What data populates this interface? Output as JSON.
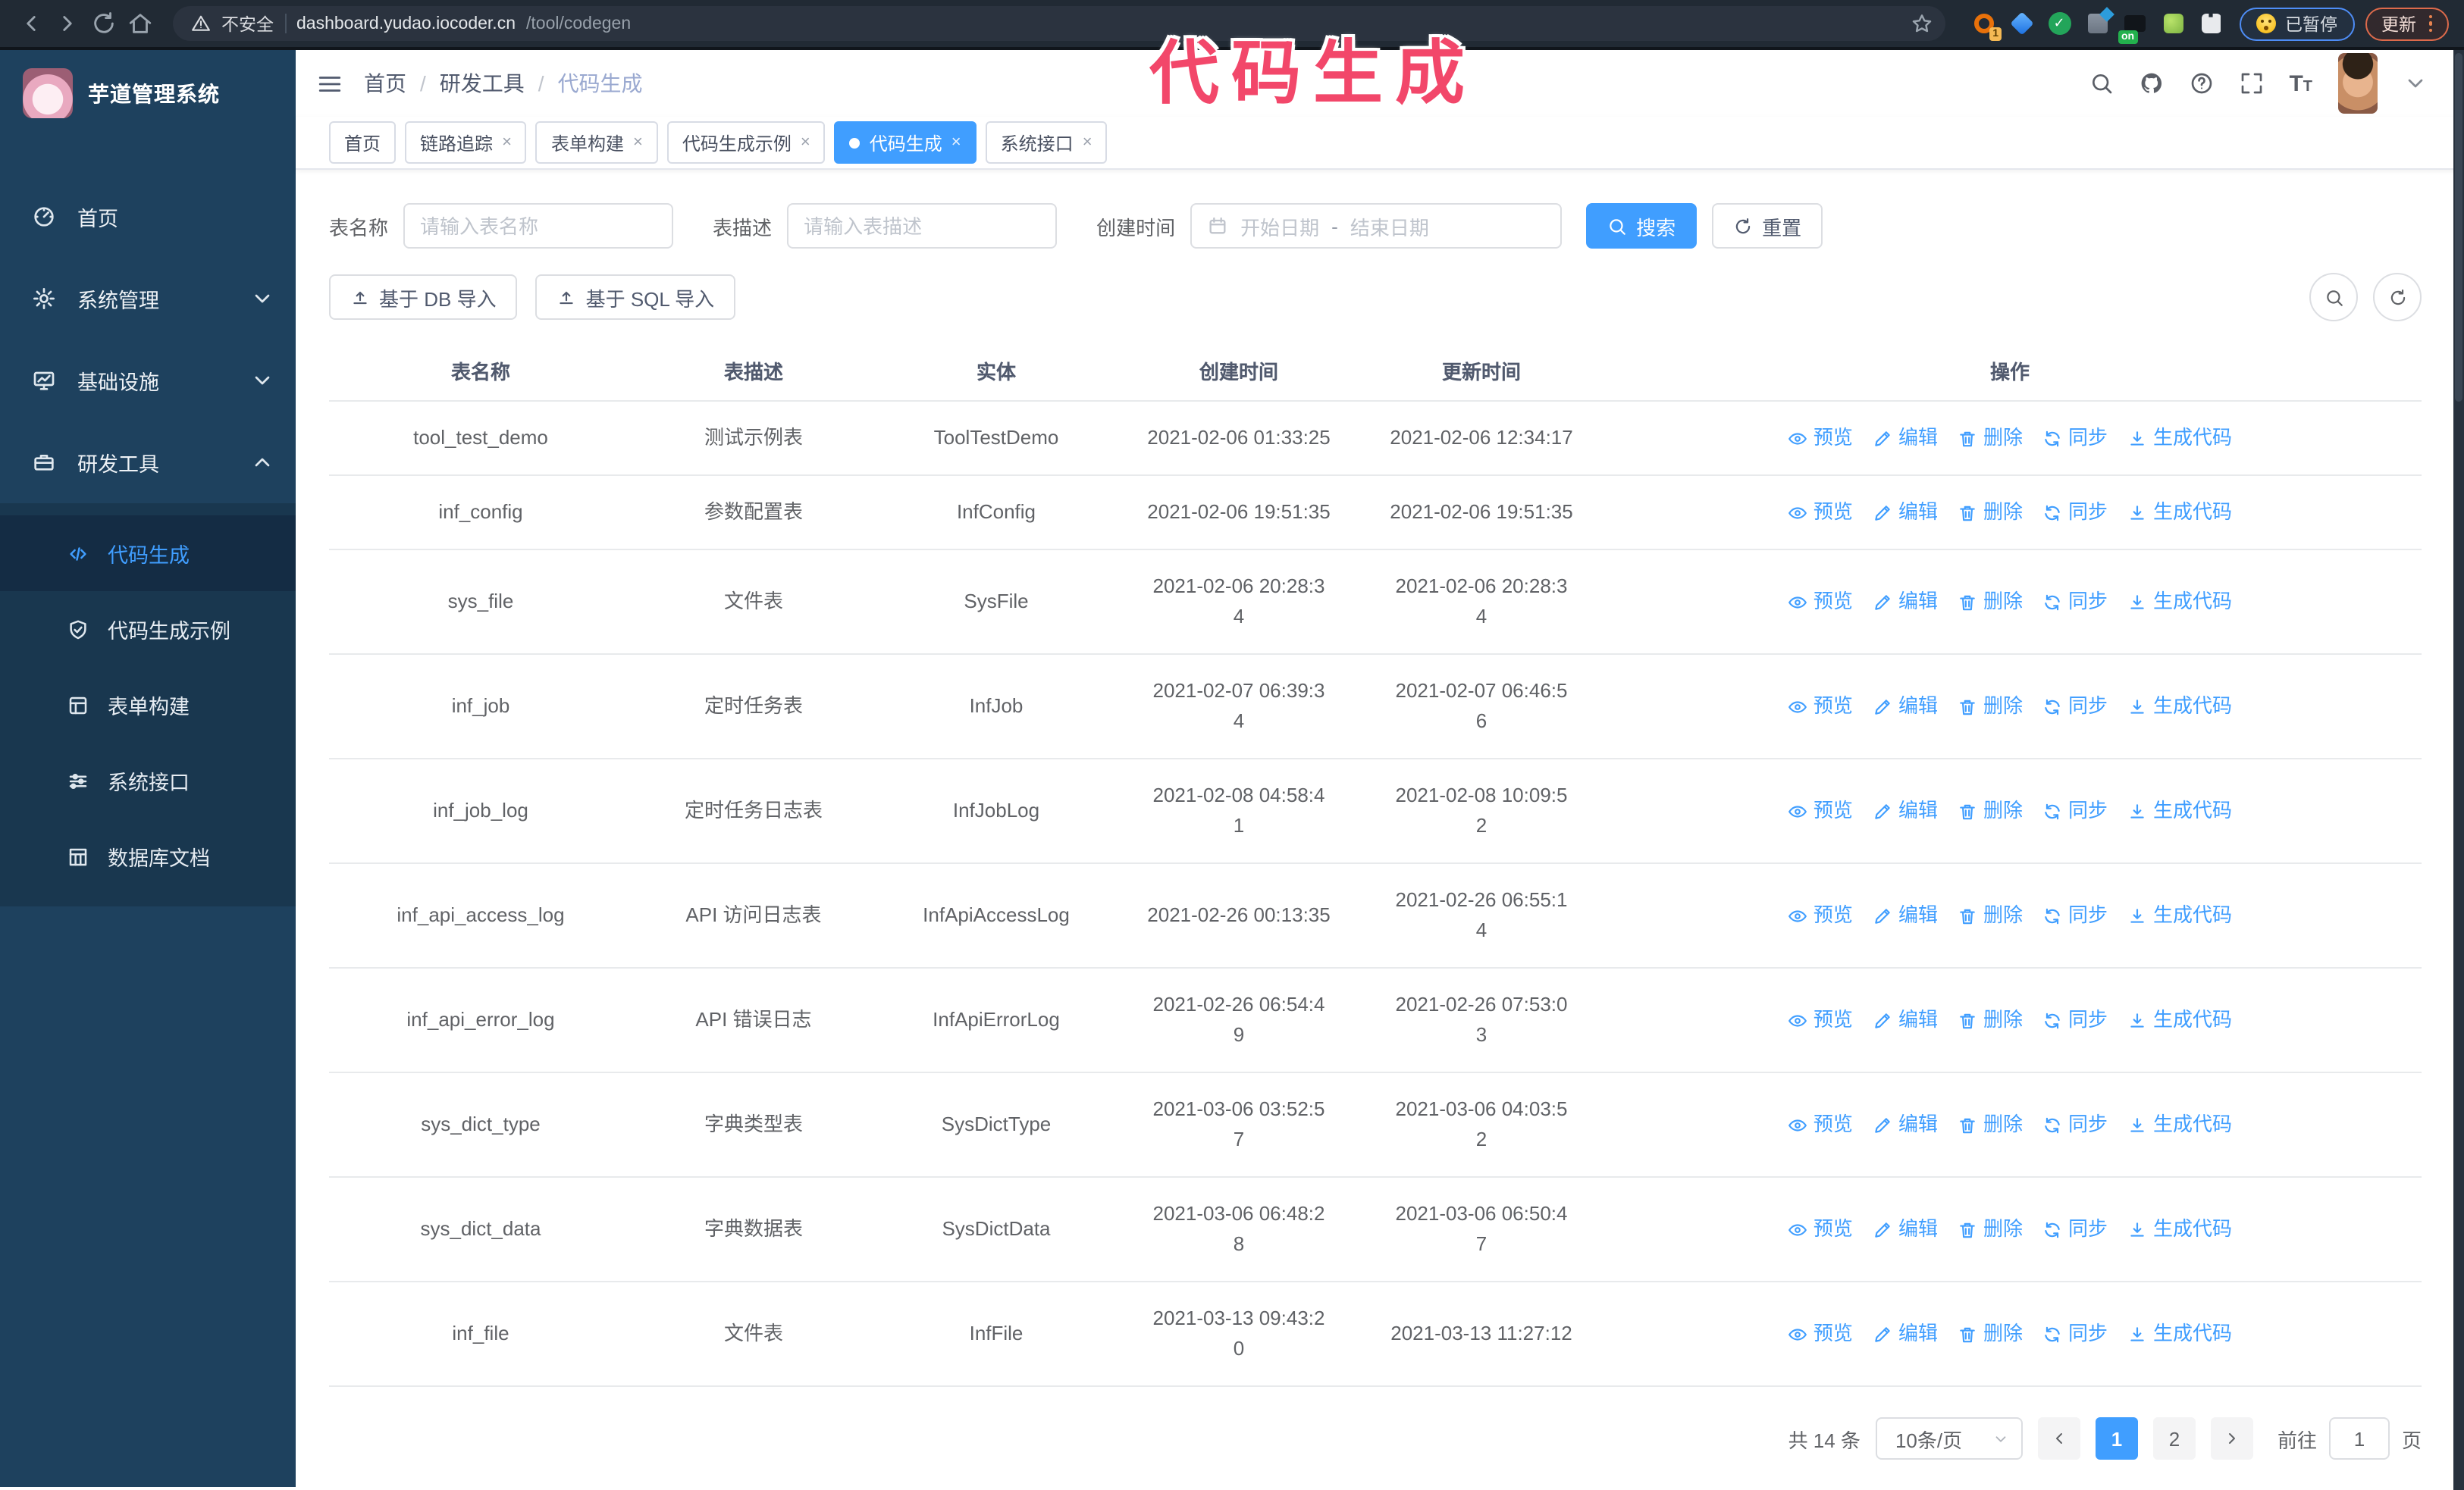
{
  "browser": {
    "security_label": "不安全",
    "url_host": "dashboard.yudao.iocoder.cn",
    "url_path": "/tool/codegen",
    "extension_badge": "1",
    "extension_on_label": "on",
    "paused_label": "已暂停",
    "update_label": "更新"
  },
  "annotation": {
    "text": "代码生成",
    "color": "#f2476a"
  },
  "sidebar": {
    "logo_title": "芋道管理系统",
    "items": [
      {
        "label": "首页",
        "icon": "dashboard-icon",
        "chevron": ""
      },
      {
        "label": "系统管理",
        "icon": "gear-icon",
        "chevron": "down"
      },
      {
        "label": "基础设施",
        "icon": "infrastructure-icon",
        "chevron": "down"
      },
      {
        "label": "研发工具",
        "icon": "toolbox-icon",
        "chevron": "up"
      }
    ],
    "submenu": [
      {
        "label": "代码生成",
        "icon": "code-icon",
        "active": true
      },
      {
        "label": "代码生成示例",
        "icon": "shield-check-icon",
        "active": false
      },
      {
        "label": "表单构建",
        "icon": "form-icon",
        "active": false
      },
      {
        "label": "系统接口",
        "icon": "sliders-icon",
        "active": false
      },
      {
        "label": "数据库文档",
        "icon": "database-icon",
        "active": false
      }
    ]
  },
  "topbar": {
    "breadcrumb": [
      "首页",
      "研发工具",
      "代码生成"
    ],
    "tabs": [
      {
        "label": "首页",
        "closable": false,
        "active": false
      },
      {
        "label": "链路追踪",
        "closable": true,
        "active": false
      },
      {
        "label": "表单构建",
        "closable": true,
        "active": false
      },
      {
        "label": "代码生成示例",
        "closable": true,
        "active": false
      },
      {
        "label": "代码生成",
        "closable": true,
        "active": true
      },
      {
        "label": "系统接口",
        "closable": true,
        "active": false
      }
    ]
  },
  "filters": {
    "table_name_label": "表名称",
    "table_name_placeholder": "请输入表名称",
    "table_desc_label": "表描述",
    "table_desc_placeholder": "请输入表描述",
    "create_time_label": "创建时间",
    "date_start_placeholder": "开始日期",
    "date_separator": "-",
    "date_end_placeholder": "结束日期",
    "search_label": "搜索",
    "reset_label": "重置"
  },
  "toolbar": {
    "import_db_label": "基于 DB 导入",
    "import_sql_label": "基于 SQL 导入"
  },
  "table": {
    "columns": [
      "表名称",
      "表描述",
      "实体",
      "创建时间",
      "更新时间",
      "操作"
    ],
    "action_labels": [
      "预览",
      "编辑",
      "删除",
      "同步",
      "生成代码"
    ],
    "rows": [
      {
        "name": "tool_test_demo",
        "desc": "测试示例表",
        "entity": "ToolTestDemo",
        "created_lines": [
          "2021-02-06 01:33:25"
        ],
        "updated_lines": [
          "2021-02-06 12:34:17"
        ]
      },
      {
        "name": "inf_config",
        "desc": "参数配置表",
        "entity": "InfConfig",
        "created_lines": [
          "2021-02-06 19:51:35"
        ],
        "updated_lines": [
          "2021-02-06 19:51:35"
        ]
      },
      {
        "name": "sys_file",
        "desc": "文件表",
        "entity": "SysFile",
        "created_lines": [
          "2021-02-06 20:28:3",
          "4"
        ],
        "updated_lines": [
          "2021-02-06 20:28:3",
          "4"
        ]
      },
      {
        "name": "inf_job",
        "desc": "定时任务表",
        "entity": "InfJob",
        "created_lines": [
          "2021-02-07 06:39:3",
          "4"
        ],
        "updated_lines": [
          "2021-02-07 06:46:5",
          "6"
        ]
      },
      {
        "name": "inf_job_log",
        "desc": "定时任务日志表",
        "entity": "InfJobLog",
        "created_lines": [
          "2021-02-08 04:58:4",
          "1"
        ],
        "updated_lines": [
          "2021-02-08 10:09:5",
          "2"
        ]
      },
      {
        "name": "inf_api_access_log",
        "desc": "API 访问日志表",
        "entity": "InfApiAccessLog",
        "created_lines": [
          "2021-02-26 00:13:35"
        ],
        "updated_lines": [
          "2021-02-26 06:55:1",
          "4"
        ]
      },
      {
        "name": "inf_api_error_log",
        "desc": "API 错误日志",
        "entity": "InfApiErrorLog",
        "created_lines": [
          "2021-02-26 06:54:4",
          "9"
        ],
        "updated_lines": [
          "2021-02-26 07:53:0",
          "3"
        ]
      },
      {
        "name": "sys_dict_type",
        "desc": "字典类型表",
        "entity": "SysDictType",
        "created_lines": [
          "2021-03-06 03:52:5",
          "7"
        ],
        "updated_lines": [
          "2021-03-06 04:03:5",
          "2"
        ]
      },
      {
        "name": "sys_dict_data",
        "desc": "字典数据表",
        "entity": "SysDictData",
        "created_lines": [
          "2021-03-06 06:48:2",
          "8"
        ],
        "updated_lines": [
          "2021-03-06 06:50:4",
          "7"
        ]
      },
      {
        "name": "inf_file",
        "desc": "文件表",
        "entity": "InfFile",
        "created_lines": [
          "2021-03-13 09:43:2",
          "0"
        ],
        "updated_lines": [
          "2021-03-13 11:27:12"
        ]
      }
    ]
  },
  "pagination": {
    "total_label": "共 14 条",
    "page_size_label": "10条/页",
    "pages": [
      "1",
      "2"
    ],
    "active_page": "1",
    "goto_label": "前往",
    "goto_value": "1",
    "goto_unit": "页"
  },
  "colors": {
    "primary": "#409eff",
    "sidebar_bg": "#1e415e",
    "submenu_bg": "#19374f",
    "submenu_active_bg": "#142c44",
    "annotation": "#f2476a"
  }
}
